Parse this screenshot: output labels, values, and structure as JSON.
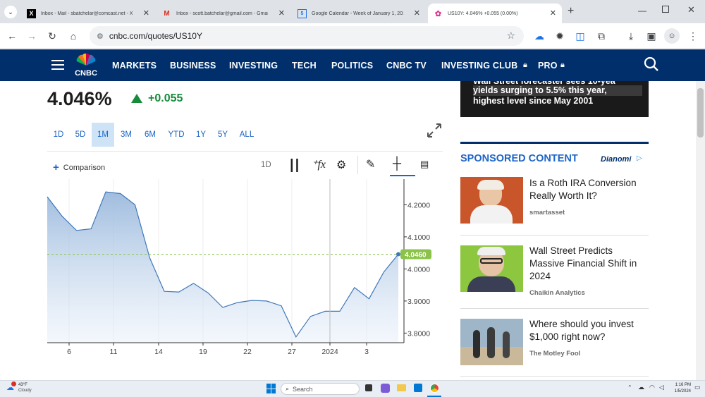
{
  "browser": {
    "tabs": [
      {
        "title": "Inbox - Mail - sbatchelar@comcast.net - Xfinity",
        "icon": "x-icon"
      },
      {
        "title": "Inbox - scott.batchelar@gmail.com - Gmail",
        "icon": "gmail-icon"
      },
      {
        "title": "Google Calendar - Week of January 1, 2024",
        "icon": "calendar-icon"
      },
      {
        "title": "US10Y: 4.046% +0.055 (0.00%)",
        "icon": "cnbc-icon"
      }
    ],
    "url": "cnbc.com/quotes/US10Y"
  },
  "nav": {
    "logo": "CNBC",
    "items": [
      "MARKETS",
      "BUSINESS",
      "INVESTING",
      "TECH",
      "POLITICS",
      "CNBC TV",
      "INVESTING CLUB",
      "PRO"
    ]
  },
  "quote": {
    "price": "4.046%",
    "change": "+0.055"
  },
  "ranges": [
    "1D",
    "5D",
    "1M",
    "3M",
    "6M",
    "YTD",
    "1Y",
    "5Y",
    "ALL"
  ],
  "selected_range": "1M",
  "chart_tools": {
    "comparison": "Comparison",
    "interval": "1D"
  },
  "chart_data": {
    "type": "area",
    "x_ticks": [
      "6",
      "11",
      "14",
      "19",
      "22",
      "27",
      "2024",
      "3"
    ],
    "y_ticks": [
      "4.2000",
      "4.1000",
      "4.0000",
      "3.9000",
      "3.8000"
    ],
    "ylim": [
      3.77,
      4.28
    ],
    "last_label": "4.0460",
    "values": [
      4.225,
      4.165,
      4.12,
      4.125,
      4.24,
      4.235,
      4.2,
      4.035,
      3.93,
      3.928,
      3.955,
      3.925,
      3.88,
      3.895,
      3.902,
      3.9,
      3.885,
      3.788,
      3.852,
      3.868,
      3.868,
      3.942,
      3.907,
      3.99,
      4.046
    ],
    "color": "#3f78b8"
  },
  "ad_banner": {
    "line1": "Wall Street forecaster sees 10-yea",
    "line2": "yields surging to 5.5% this year,",
    "line3": "highest level since May 2001"
  },
  "sponsored": {
    "heading": "SPONSORED CONTENT",
    "brand": "Dianomi",
    "items": [
      {
        "title": "Is a Roth IRA Conversion Really Worth It?",
        "source": "smartasset"
      },
      {
        "title": "Wall Street Predicts Massive Financial Shift in 2024",
        "source": "Chaikin Analytics"
      },
      {
        "title": "Where should you invest $1,000 right now?",
        "source": "The Motley Fool"
      }
    ]
  },
  "taskbar": {
    "temp": "43°F",
    "weather": "Cloudy",
    "search": "Search",
    "time": "1:16 PM",
    "date": "1/5/2024"
  }
}
